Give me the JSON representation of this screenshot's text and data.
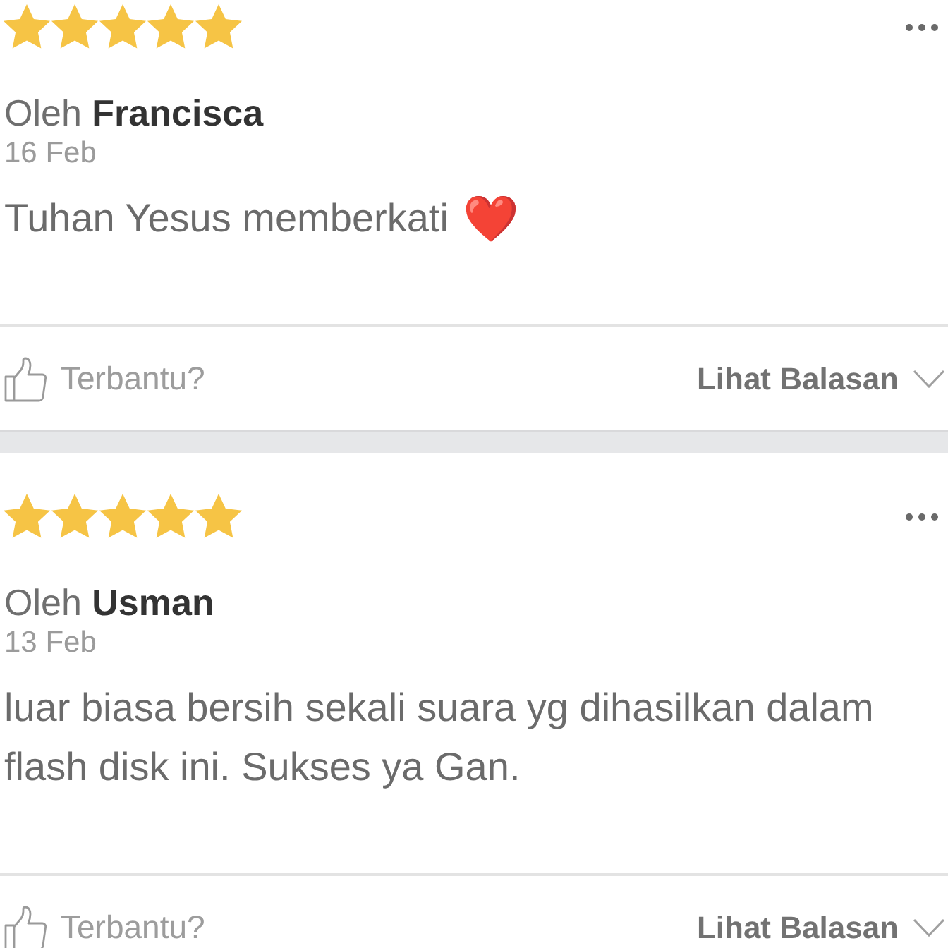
{
  "reviews": [
    {
      "stars": 5,
      "author": "Oleh **Francisca**",
      "date": "16 Feb",
      "text": "Tuhan Yesus memberkati",
      "emoji": "❤️",
      "helpful_label": "Terbantu?",
      "replies_label": "Lihat Balasan"
    },
    {
      "stars": 5,
      "author": "Oleh **Usman**",
      "date": "13 Feb",
      "text": "luar biasa bersih sekali suara yg dihasilkan dalam flash disk ini. Sukses ya Gan.",
      "helpful_label": "Terbantu?",
      "replies_label": "Lihat Balasan"
    }
  ]
}
